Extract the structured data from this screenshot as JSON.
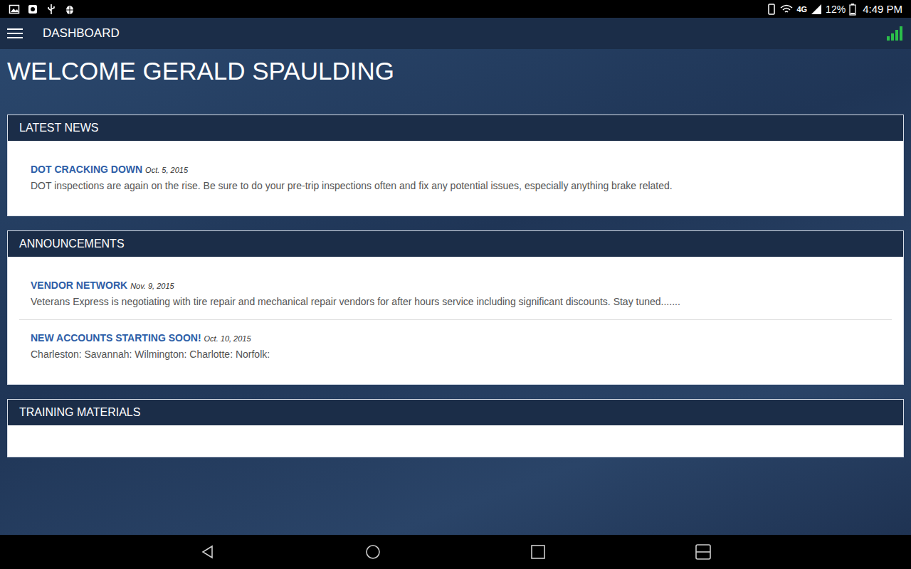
{
  "status_bar": {
    "network": "4G",
    "battery": "12%",
    "time": "4:49 PM"
  },
  "app_bar": {
    "title": "DASHBOARD"
  },
  "welcome": "WELCOME GERALD SPAULDING",
  "sections": [
    {
      "title": "LATEST NEWS",
      "items": [
        {
          "title": "DOT CRACKING DOWN",
          "date": "Oct. 5, 2015",
          "text": "DOT inspections are again on the rise. Be sure to do your pre-trip inspections often and fix any potential issues, especially anything brake related."
        }
      ]
    },
    {
      "title": "ANNOUNCEMENTS",
      "items": [
        {
          "title": "VENDOR NETWORK",
          "date": "Nov. 9, 2015",
          "text": "Veterans Express is negotiating with tire repair and mechanical repair vendors for after hours service including significant discounts. Stay tuned......."
        },
        {
          "title": "NEW ACCOUNTS STARTING SOON!",
          "date": "Oct. 10, 2015",
          "text": "Charleston: Savannah: Wilmington: Charlotte: Norfolk:"
        }
      ]
    },
    {
      "title": "TRAINING MATERIALS",
      "items": []
    }
  ]
}
